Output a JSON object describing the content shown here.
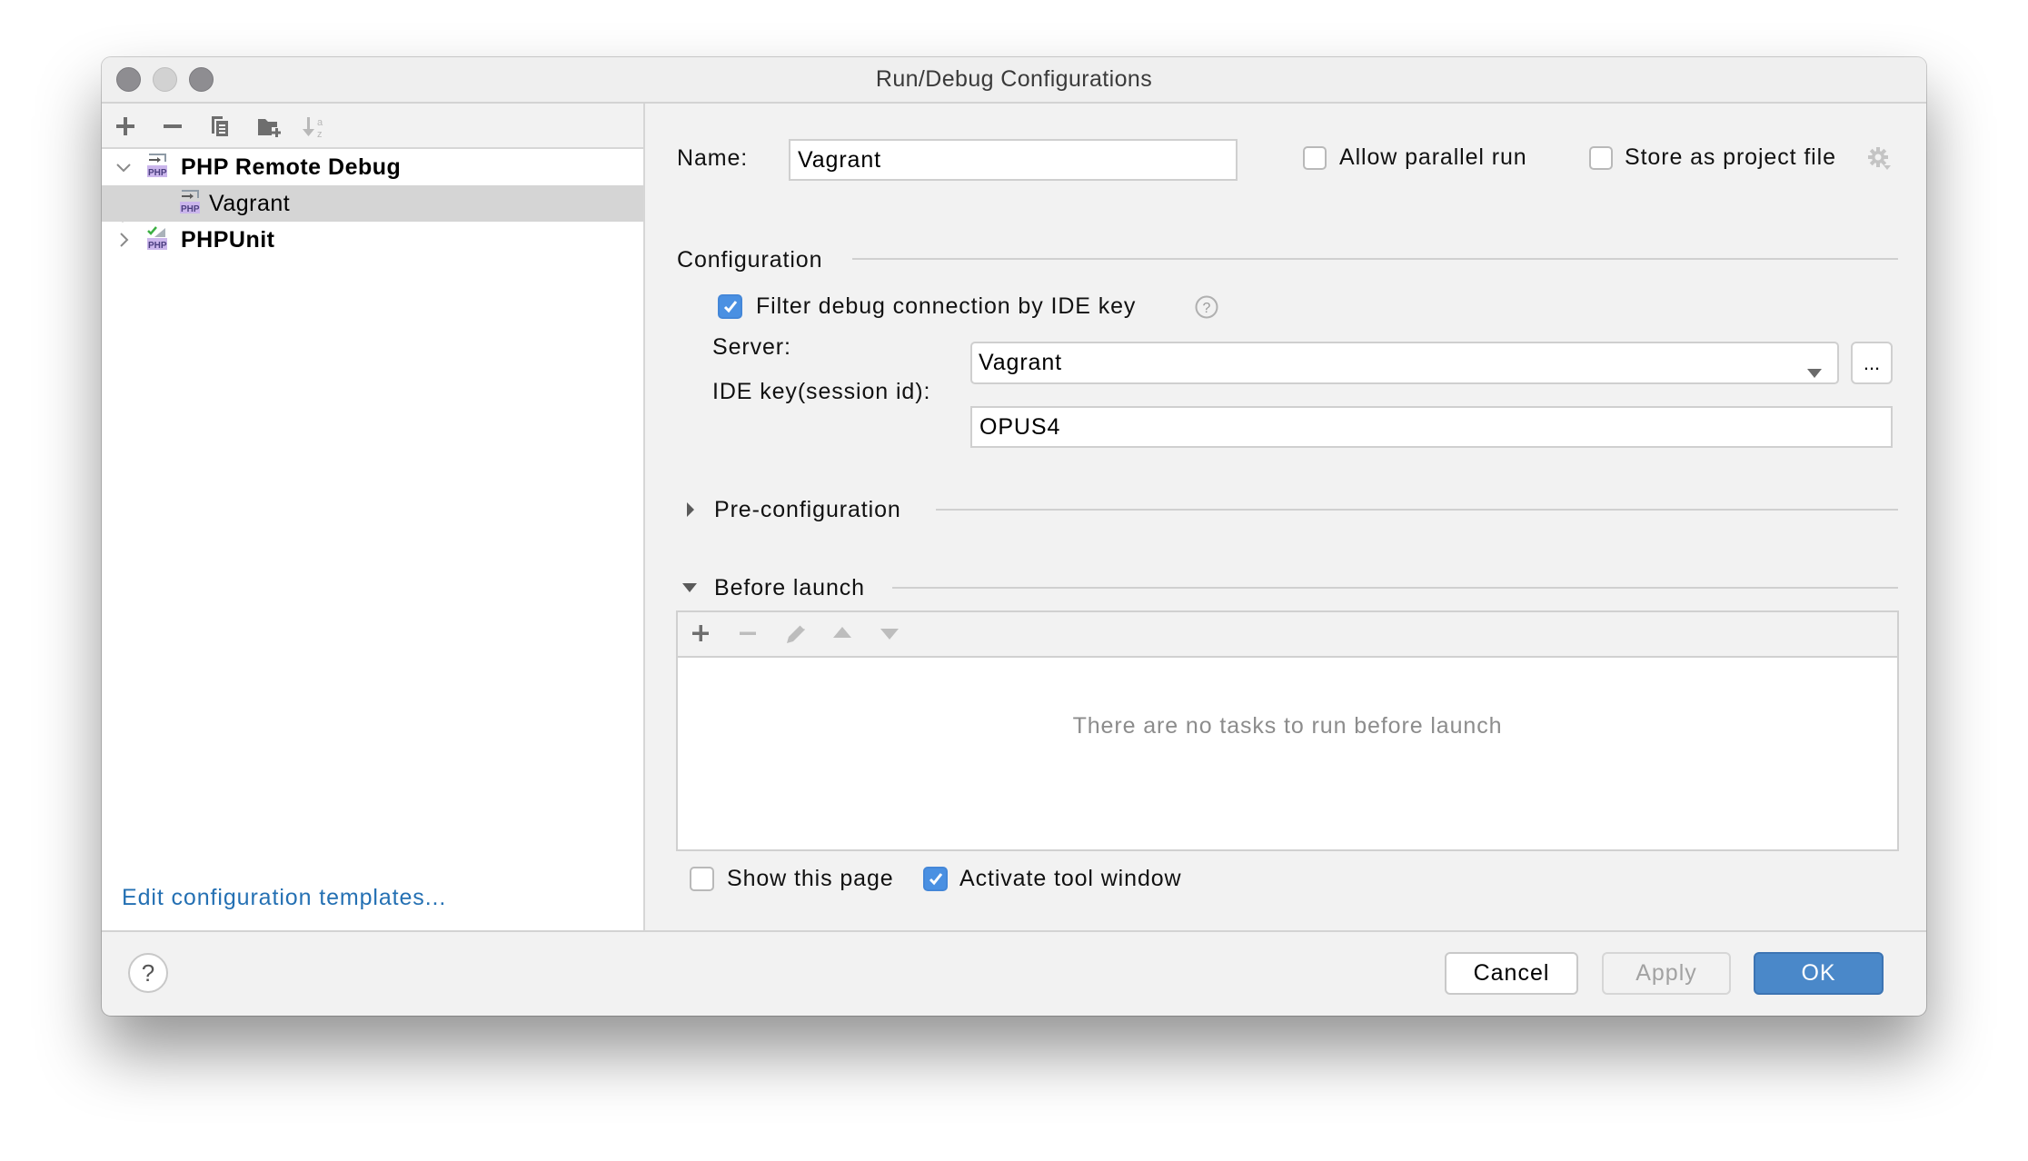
{
  "window": {
    "title": "Run/Debug Configurations"
  },
  "sidebar": {
    "toolbar": [
      {
        "name": "add-icon",
        "tooltip": "Add"
      },
      {
        "name": "remove-icon",
        "tooltip": "Remove"
      },
      {
        "name": "copy-icon",
        "tooltip": "Copy"
      },
      {
        "name": "new-folder-icon",
        "tooltip": "New folder"
      },
      {
        "name": "sort-alpha-icon",
        "tooltip": "Sort"
      }
    ],
    "tree": [
      {
        "label": "PHP Remote Debug",
        "expanded": true,
        "icon": "php-remote-debug-icon"
      },
      {
        "label": "Vagrant",
        "selected": true,
        "icon": "php-remote-debug-icon"
      },
      {
        "label": "PHPUnit",
        "expanded": false,
        "icon": "phpunit-icon"
      }
    ],
    "edit_templates_link": "Edit configuration templates..."
  },
  "form": {
    "name_label": "Name:",
    "name_value": "Vagrant",
    "allow_parallel_label": "Allow parallel run",
    "allow_parallel_checked": false,
    "store_project_label": "Store as project file",
    "store_project_checked": false,
    "configuration_header": "Configuration",
    "filter_label": "Filter debug connection by IDE key",
    "filter_checked": true,
    "server_label": "Server:",
    "server_value": "Vagrant",
    "server_more_label": "...",
    "ide_key_label": "IDE key(session id):",
    "ide_key_value": "OPUS4",
    "preconfig_header": "Pre-configuration",
    "before_launch_header": "Before launch",
    "before_launch_empty": "There are no tasks to run before launch",
    "show_page_label": "Show this page",
    "show_page_checked": false,
    "activate_tool_label": "Activate tool window",
    "activate_tool_checked": true
  },
  "footer": {
    "help_label": "?",
    "cancel_label": "Cancel",
    "apply_label": "Apply",
    "ok_label": "OK"
  },
  "colors": {
    "accent": "#4a90e2",
    "link": "#2470b3",
    "ok_button": "#4a88c9",
    "selection": "#d5d5d5"
  }
}
